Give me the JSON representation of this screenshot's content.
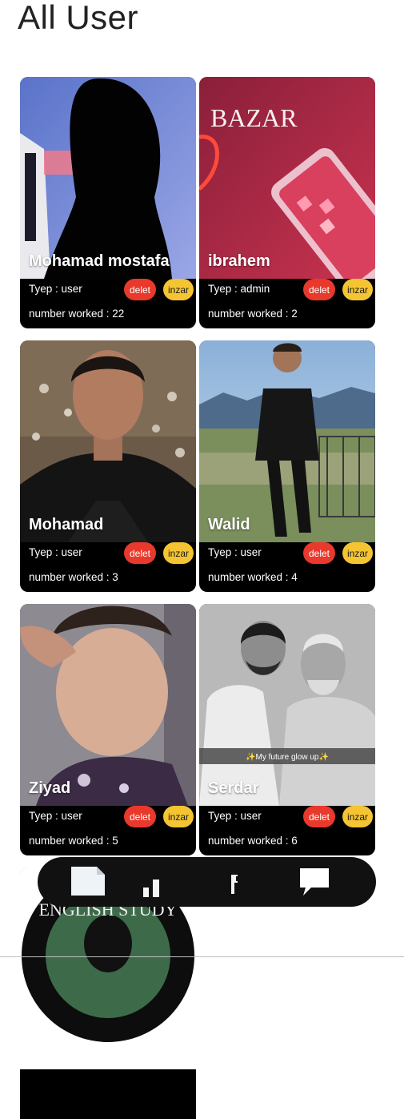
{
  "page": {
    "title": "All User"
  },
  "labels": {
    "type_prefix": "Tyep : ",
    "worked_prefix": "number worked : ",
    "delete": "delet",
    "inzar": "inzar"
  },
  "users": [
    {
      "name": "Mohamad mostafa",
      "type": "user",
      "worked": "22"
    },
    {
      "name": "ibrahem",
      "type": "admin",
      "worked": "2",
      "photo_text": "BAZAR"
    },
    {
      "name": "Mohamad",
      "type": "user",
      "worked": "3"
    },
    {
      "name": "Walid",
      "type": "user",
      "worked": "4"
    },
    {
      "name": "Ziyad",
      "type": "user",
      "worked": "5"
    },
    {
      "name": "Serdar",
      "type": "user",
      "worked": "6",
      "photo_caption": "✨My future glow up✨"
    },
    {
      "name": "",
      "photo_text": "ENGLISH STUDY"
    }
  ],
  "nav": {
    "items": [
      "document-icon",
      "bar-chart-icon",
      "phone-icon",
      "chat-bubble-icon"
    ]
  },
  "colors": {
    "delete": "#e8392c",
    "inzar": "#f4c433",
    "card": "#000000",
    "nav": "#111111"
  }
}
